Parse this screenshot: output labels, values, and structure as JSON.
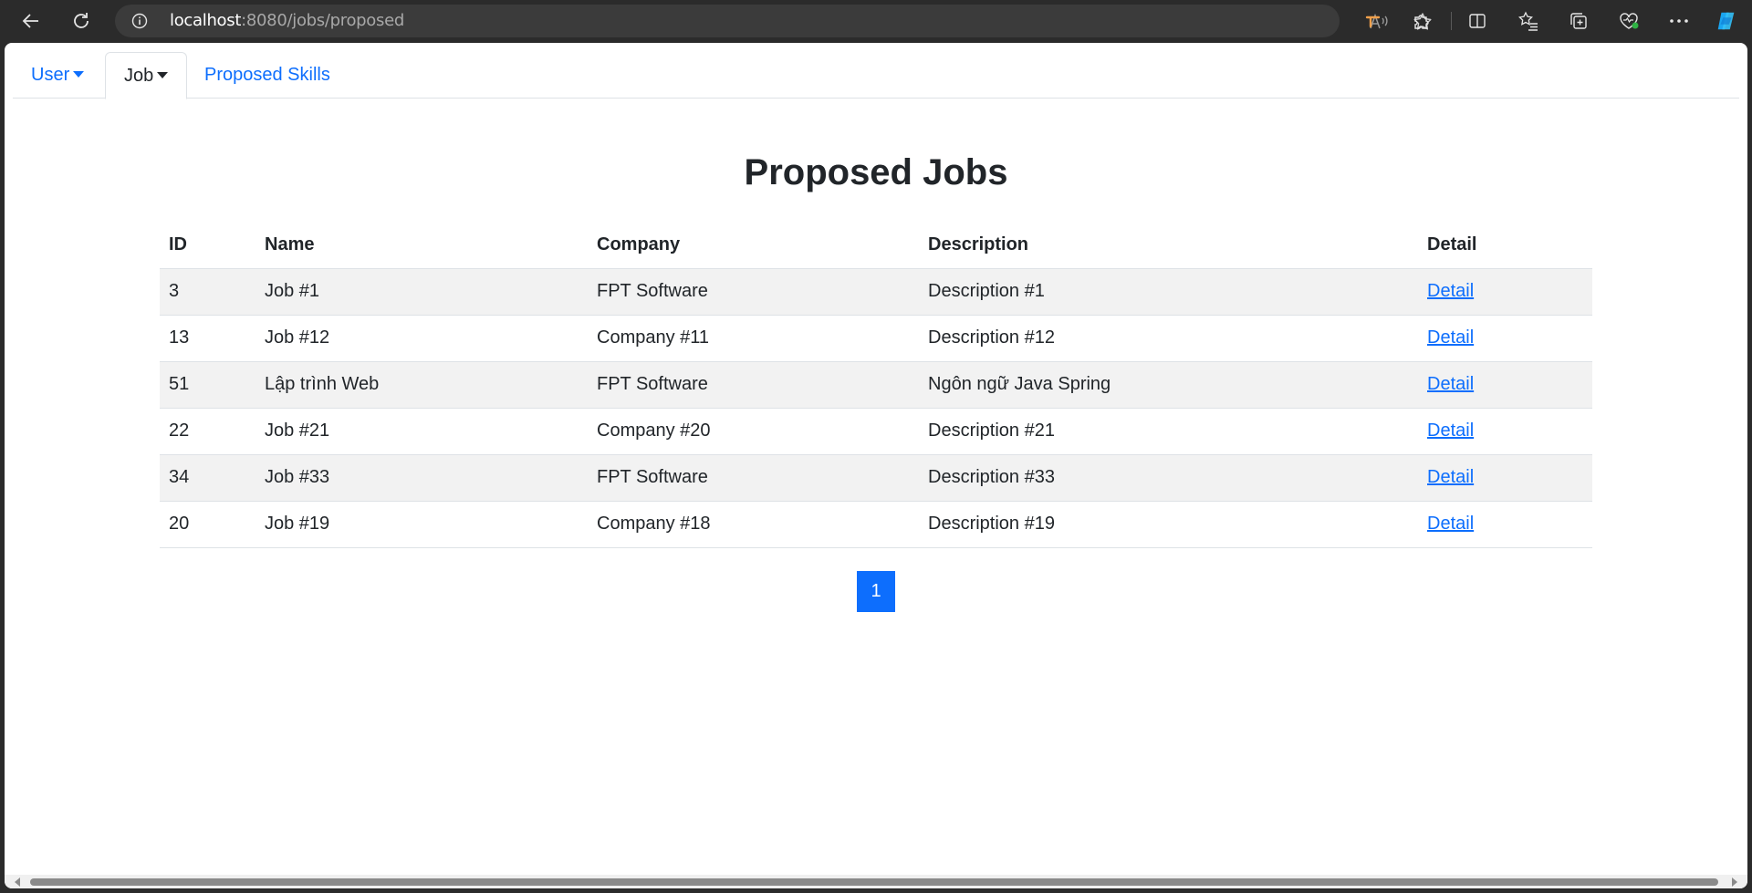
{
  "browser": {
    "url_host": "localhost",
    "url_path": ":8080/jobs/proposed"
  },
  "nav": {
    "tabs": [
      {
        "label": "User",
        "dropdown": true,
        "active": false
      },
      {
        "label": "Job",
        "dropdown": true,
        "active": true
      },
      {
        "label": "Proposed Skills",
        "dropdown": false,
        "active": false
      }
    ]
  },
  "page": {
    "title": "Proposed Jobs"
  },
  "table": {
    "headers": [
      "ID",
      "Name",
      "Company",
      "Description",
      "Detail"
    ],
    "rows": [
      {
        "id": "3",
        "name": "Job #1",
        "company": "FPT Software",
        "description": "Description #1",
        "detail": "Detail"
      },
      {
        "id": "13",
        "name": "Job #12",
        "company": "Company #11",
        "description": "Description #12",
        "detail": "Detail"
      },
      {
        "id": "51",
        "name": "Lập trình Web",
        "company": "FPT Software",
        "description": "Ngôn ngữ Java Spring",
        "detail": "Detail"
      },
      {
        "id": "22",
        "name": "Job #21",
        "company": "Company #20",
        "description": "Description #21",
        "detail": "Detail"
      },
      {
        "id": "34",
        "name": "Job #33",
        "company": "FPT Software",
        "description": "Description #33",
        "detail": "Detail"
      },
      {
        "id": "20",
        "name": "Job #19",
        "company": "Company #18",
        "description": "Description #19",
        "detail": "Detail"
      }
    ]
  },
  "pagination": {
    "current_page": "1"
  },
  "colors": {
    "accent": "#0d6efd",
    "stripe": "#f2f2f2",
    "chrome_bg": "#2b2b2b"
  }
}
